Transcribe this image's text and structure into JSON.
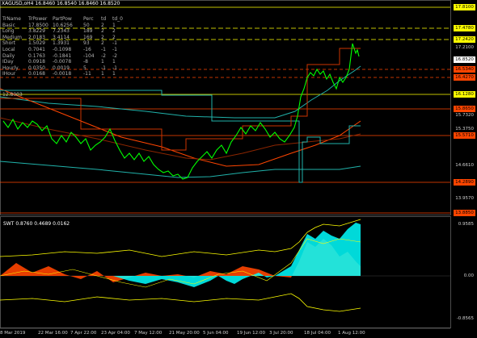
{
  "header": {
    "title": "XAGUSD,oH4  16.8460 16.8540 16.8460 16.8520"
  },
  "table": {
    "columns": [
      "TrName",
      "TrPower",
      "PartPow",
      "Perc",
      "td",
      "td_0"
    ],
    "rows": [
      [
        "Basic",
        "17.8500",
        "10.6256",
        "50",
        "2",
        "1"
      ],
      [
        "Long",
        "3.8229",
        "7.2343",
        "189",
        "2",
        "2"
      ],
      [
        "Medium",
        "2.0183",
        "3.4114",
        "169",
        "2",
        "2"
      ],
      [
        "Short",
        "1.5029",
        "1.3931",
        "93",
        "2",
        "-1"
      ],
      [
        "Local",
        "0.7041",
        "-0.1098",
        "-16",
        "-1",
        "-1"
      ],
      [
        "Daily",
        "0.1763",
        "-0.1841",
        "-104",
        "-2",
        "-2"
      ],
      [
        "IDay",
        "0.0918",
        "-0.0078",
        "-8",
        "1",
        "1"
      ],
      [
        "Hourly",
        "0.0350",
        "0.0019",
        "5",
        "-1",
        "-1"
      ],
      [
        "IHour",
        "0.0168",
        "-0.0018",
        "-11",
        "1",
        "1"
      ]
    ],
    "extra": "12.8003"
  },
  "price_axis": {
    "tags": [
      {
        "label": "17.8100",
        "color": "#ffff00"
      },
      {
        "label": "17.4780",
        "color": "#ffff00"
      },
      {
        "label": "17.2420",
        "color": "#ffff00"
      },
      {
        "label": "16.8520",
        "color": "#ffffff"
      },
      {
        "label": "16.5340",
        "color": "#ff4500"
      },
      {
        "label": "16.4270",
        "color": "#ff4500"
      },
      {
        "label": "16.1280",
        "color": "#ffff00"
      },
      {
        "label": "15.8650",
        "color": "#ff4500"
      },
      {
        "label": "15.5710",
        "color": "#ff4500"
      },
      {
        "label": "14.2890",
        "color": "#ff4500"
      },
      {
        "label": "13.8850",
        "color": "#ff4500"
      }
    ],
    "ticks": [
      "17.2100",
      "15.7320",
      "15.3750",
      "14.6610",
      "13.9570"
    ]
  },
  "indicator": {
    "title": "SWT  0.8760  0.4689  0.0162",
    "ticks": [
      "0.9585",
      "0.00",
      "-0.8565"
    ]
  },
  "time_axis": [
    "8 Mar 2019",
    "22 Mar 16:00",
    "7 Apr 22:00",
    "23 Apr 04:00",
    "7 May 12:00",
    "21 May 20:00",
    "5 Jun 04:00",
    "19 Jun 12:00",
    "3 Jul 20:00",
    "18 Jul 04:00",
    "1 Aug 12:00"
  ],
  "colors": {
    "bullish": "#00ff00",
    "bearish": "#ff4500",
    "ma_teal": "#20b2aa",
    "ma_orange": "#ff4500",
    "level": "#ffff00",
    "ind_orange": "#ff4500",
    "ind_cyan": "#00ffff"
  }
}
